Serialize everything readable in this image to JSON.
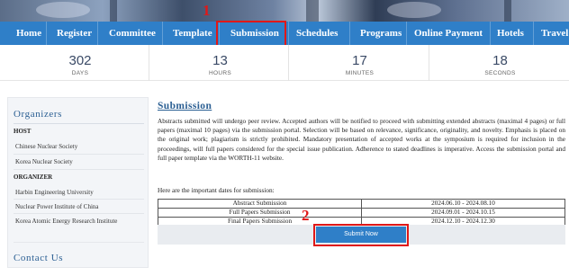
{
  "nav": {
    "items": [
      "Home",
      "Register",
      "Committee",
      "Template",
      "Submission",
      "Schedules",
      "Programs",
      "Online Payment",
      "Hotels",
      "Travel"
    ],
    "active": "Submission",
    "color": "#2f7fc8"
  },
  "annotations": {
    "marker1": "1",
    "marker2": "2",
    "color": "#e01818"
  },
  "countdown": [
    {
      "value": "302",
      "label": "DAYS"
    },
    {
      "value": "13",
      "label": "HOURS"
    },
    {
      "value": "17",
      "label": "MINUTES"
    },
    {
      "value": "18",
      "label": "SECONDS"
    }
  ],
  "sidebar": {
    "organizers_title": "Organizers",
    "host_heading": "HOST",
    "host_items": [
      "Chinese Nuclear Society",
      "Korea Nuclear Society"
    ],
    "organizer_heading": "ORGANIZER",
    "organizer_items": [
      "Harbin Engineering University",
      "Nuclear Power Institute of China",
      "Korea Atomic Energy Research Institute"
    ],
    "contact_title": "Contact Us"
  },
  "main": {
    "title": "Submission",
    "paragraph": "Abstracts submitted will undergo peer review. Accepted authors will be notified to proceed with submitting extended abstracts (maximal 4 pages) or full papers (maximal 10 pages) via the submission portal. Selection will be based on relevance, significance, originality, and novelty. Emphasis is placed on the original work; plagiarism is strictly prohibited. Mandatory presentation of accepted works at the symposium is required for inclusion in the proceedings, will full papers considered for the special issue publication. Adherence to stated deadlines is imperative. Access the submission portal and full paper template via the WORTH-11 website.",
    "dates_intro": "Here are the important dates for submission:",
    "dates": [
      {
        "item": "Abstract Submission",
        "range": "2024.06.10 - 2024.08.10"
      },
      {
        "item": "Full Papers Submission",
        "range": "2024.09.01 - 2024.10.15"
      },
      {
        "item": "Final Papers Submission",
        "range": "2024.12.10 - 2024.12.30"
      }
    ],
    "submit_label": "Submit Now"
  }
}
